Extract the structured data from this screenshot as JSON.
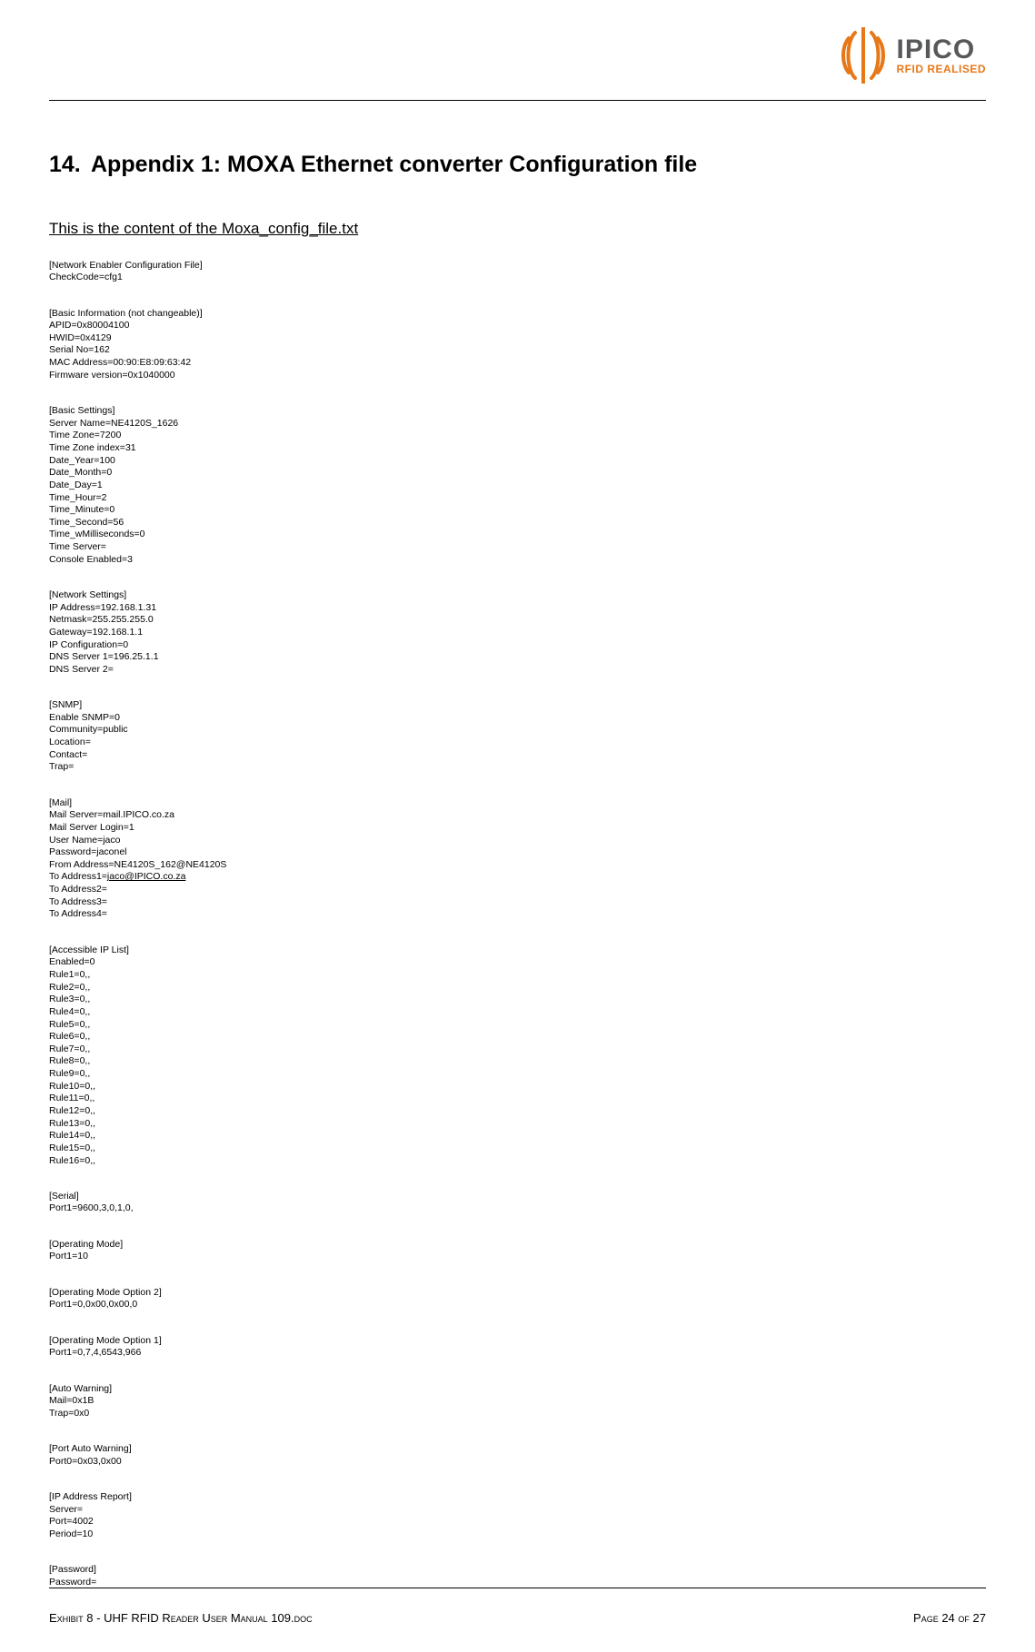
{
  "logo": {
    "brand_text": "IPICO",
    "tagline": "RFID REALISED"
  },
  "section": {
    "number": "14.",
    "title": "Appendix 1: MOXA Ethernet converter Configuration file",
    "subheading": "This is the content of the Moxa_config_file.txt"
  },
  "config": {
    "network_enabler": [
      "[Network Enabler Configuration File]",
      "CheckCode=cfg1"
    ],
    "basic_info": [
      "[Basic Information (not changeable)]",
      "APID=0x80004100",
      "HWID=0x4129",
      "Serial No=162",
      "MAC Address=00:90:E8:09:63:42",
      "Firmware version=0x1040000"
    ],
    "basic_settings": [
      "[Basic Settings]",
      "Server Name=NE4120S_1626",
      "Time Zone=7200",
      "Time Zone index=31",
      "Date_Year=100",
      "Date_Month=0",
      "Date_Day=1",
      "Time_Hour=2",
      "Time_Minute=0",
      "Time_Second=56",
      "Time_wMilliseconds=0",
      "Time Server=",
      "Console Enabled=3"
    ],
    "network_settings": [
      "[Network Settings]",
      "IP Address=192.168.1.31",
      "Netmask=255.255.255.0",
      "Gateway=192.168.1.1",
      "IP Configuration=0",
      "DNS Server 1=196.25.1.1",
      "DNS Server 2="
    ],
    "snmp": [
      "[SNMP]",
      "Enable SNMP=0",
      "Community=public",
      "Location=",
      "Contact=",
      "Trap="
    ],
    "mail_pre": [
      "[Mail]",
      "Mail Server=mail.IPICO.co.za",
      "Mail Server Login=1",
      "User Name=jaco",
      "Password=jaconel",
      "From Address=NE4120S_162@NE4120S"
    ],
    "mail_to1_label": "To Address1=",
    "mail_to1_link": "jaco@IPICO.co.za",
    "mail_post": [
      "To Address2=",
      "To Address3=",
      "To Address4="
    ],
    "accessible_ip": [
      "[Accessible IP List]",
      "Enabled=0",
      "Rule1=0,,",
      "Rule2=0,,",
      "Rule3=0,,",
      "Rule4=0,,",
      "Rule5=0,,",
      "Rule6=0,,",
      "Rule7=0,,",
      "Rule8=0,,",
      "Rule9=0,,",
      "Rule10=0,,",
      "Rule11=0,,",
      "Rule12=0,,",
      "Rule13=0,,",
      "Rule14=0,,",
      "Rule15=0,,",
      "Rule16=0,,"
    ],
    "serial": [
      "[Serial]",
      "Port1=9600,3,0,1,0,"
    ],
    "op_mode": [
      "[Operating Mode]",
      "Port1=10"
    ],
    "op_mode_opt2": [
      "[Operating Mode Option 2]",
      "Port1=0,0x00,0x00,0"
    ],
    "op_mode_opt1": [
      "[Operating Mode Option 1]",
      "Port1=0,7,4,6543,966"
    ],
    "auto_warning": [
      "[Auto Warning]",
      "Mail=0x1B",
      "Trap=0x0"
    ],
    "port_auto_warning": [
      "[Port Auto Warning]",
      "Port0=0x03,0x00"
    ],
    "ip_addr_report": [
      "[IP Address Report]",
      "Server=",
      "Port=4002",
      "Period=10"
    ],
    "password": [
      "[Password]",
      "Password="
    ]
  },
  "footer": {
    "doc_name": "Exhibit 8 - UHF RFID Reader User Manual 109.doc",
    "page_prefix": "Page ",
    "page_current": "24",
    "page_sep": " of ",
    "page_total": "27"
  }
}
